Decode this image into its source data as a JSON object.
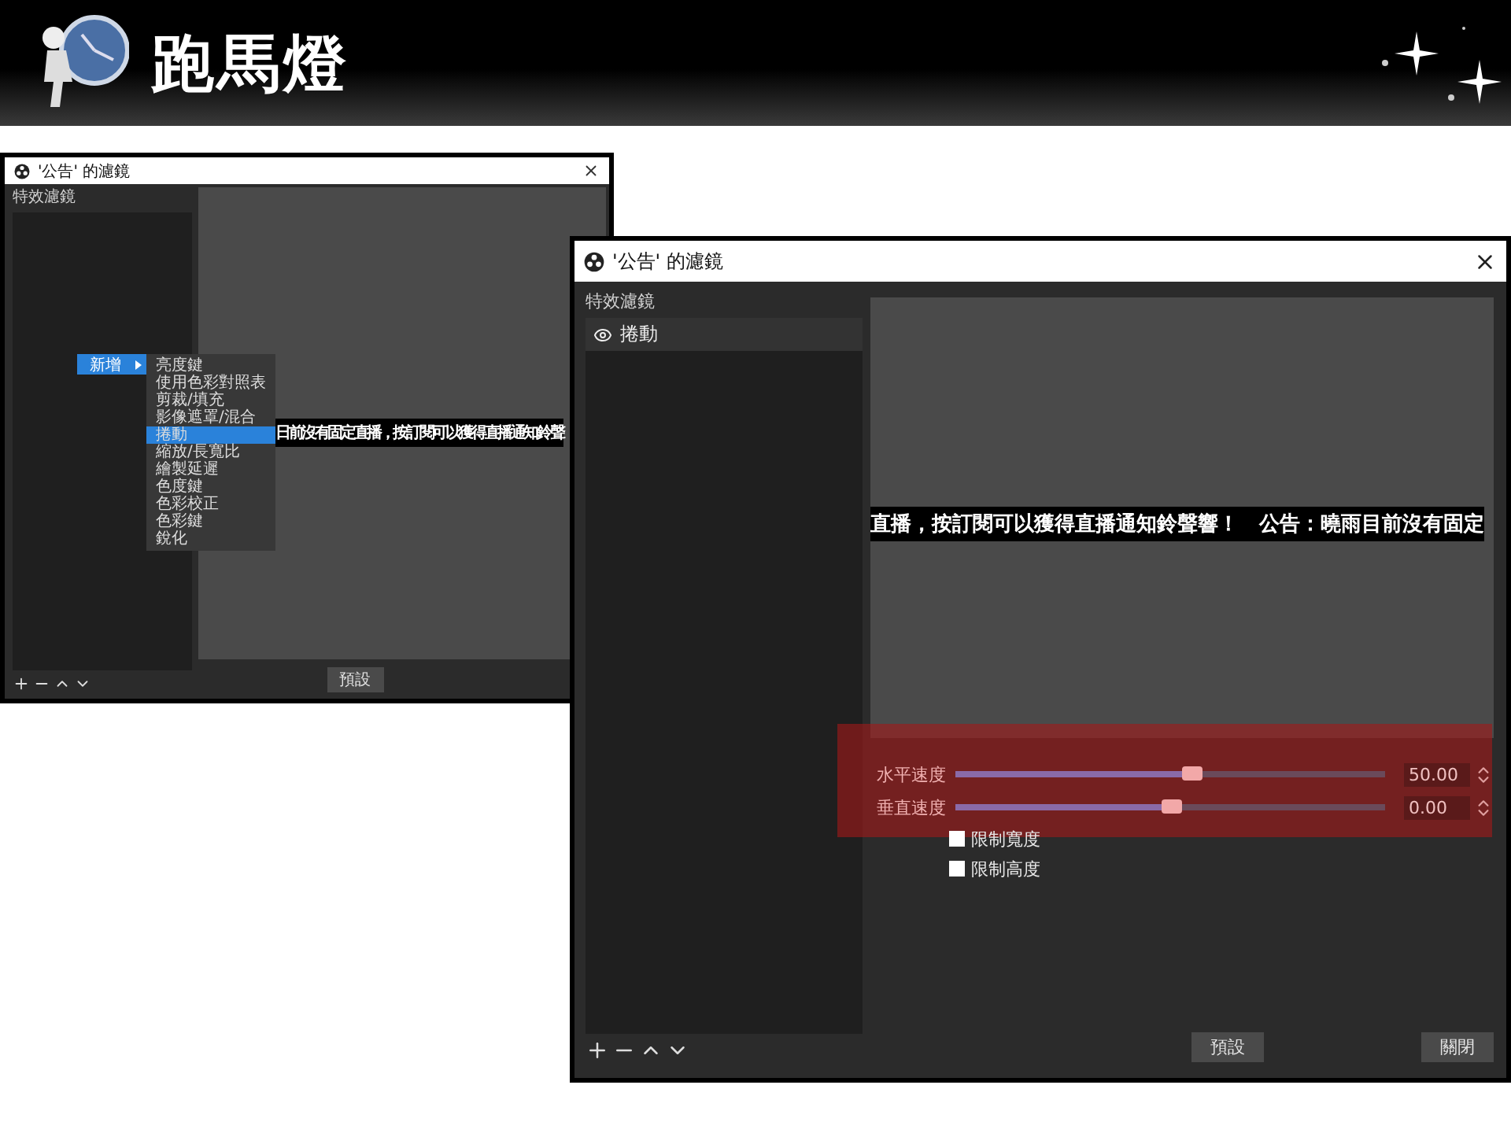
{
  "header": {
    "title": "跑馬燈"
  },
  "background_window": {
    "title": "'公告' 的濾鏡",
    "filters_label": "特效濾鏡",
    "context_menu": {
      "label": "新增",
      "items": [
        {
          "label": "亮度鍵",
          "selected": false
        },
        {
          "label": "使用色彩對照表",
          "selected": false
        },
        {
          "label": "剪裁/填充",
          "selected": false
        },
        {
          "label": "影像遮罩/混合",
          "selected": false
        },
        {
          "label": "捲動",
          "selected": true
        },
        {
          "label": "縮放/長寬比",
          "selected": false
        },
        {
          "label": "繪製延遲",
          "selected": false
        },
        {
          "label": "色度鍵",
          "selected": false
        },
        {
          "label": "色彩校正",
          "selected": false
        },
        {
          "label": "色彩鍵",
          "selected": false
        },
        {
          "label": "銳化",
          "selected": false
        }
      ]
    },
    "preview_text": "日前沒有固定直播，按訂閱可以獲得直播通知鈴聲",
    "buttons": [
      "預設"
    ]
  },
  "front_window": {
    "title": "'公告' 的濾鏡",
    "filters_label": "特效濾鏡",
    "filters": [
      {
        "label": "捲動",
        "visible": true,
        "selected": true
      }
    ],
    "preview_text": "直播，按訂閱可以獲得直播通知鈴聲響！　公告：曉雨目前沒有固定",
    "sliders": [
      {
        "label": "水平速度",
        "level": 0.55,
        "value": "50.00"
      },
      {
        "label": "垂直速度",
        "level": 0.5,
        "value": "0.00"
      }
    ],
    "checkboxes": [
      {
        "label": "限制寬度",
        "checked": false
      },
      {
        "label": "限制高度",
        "checked": false
      }
    ],
    "buttons": [
      "預設",
      "關閉"
    ]
  }
}
